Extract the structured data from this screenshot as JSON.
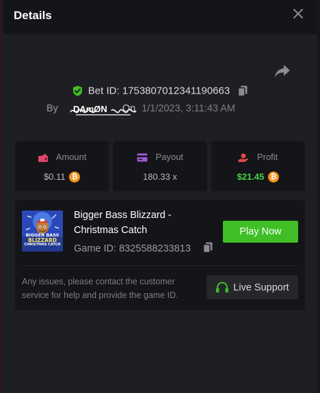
{
  "header": {
    "title": "Details",
    "close_icon": "close-icon"
  },
  "bet": {
    "id_label": "Bet ID:",
    "id_value": "1753807012341190663",
    "by_label": "By",
    "username": "DAmØN",
    "on_label": "On",
    "datetime": "1/1/2023, 3:11:43 AM"
  },
  "stats": {
    "amount": {
      "label": "Amount",
      "value": "$0.11",
      "icon": "wallet-icon"
    },
    "payout": {
      "label": "Payout",
      "value": "180.33 x",
      "icon": "card-icon"
    },
    "profit": {
      "label": "Profit",
      "value": "$21.45",
      "icon": "hand-coin-icon"
    }
  },
  "game": {
    "name": "Bigger Bass Blizzard - Christmas Catch",
    "thumb_text_1": "BIGGER BASS",
    "thumb_text_2": "BLIZZARD",
    "thumb_text_3": "CHRISTMAS CATCH",
    "id_label": "Game ID:",
    "id_value": "8325588233813",
    "play_label": "Play Now"
  },
  "support": {
    "message": "Any issues, please contact the customer service for help and provide the game ID.",
    "button_label": "Live Support"
  },
  "colors": {
    "accent_green": "#3fbf25",
    "profit_green": "#47d147",
    "bitcoin_orange": "#f7931a",
    "icon_pink": "#e0456b",
    "icon_purple": "#9b59d6",
    "icon_red": "#e04848"
  }
}
